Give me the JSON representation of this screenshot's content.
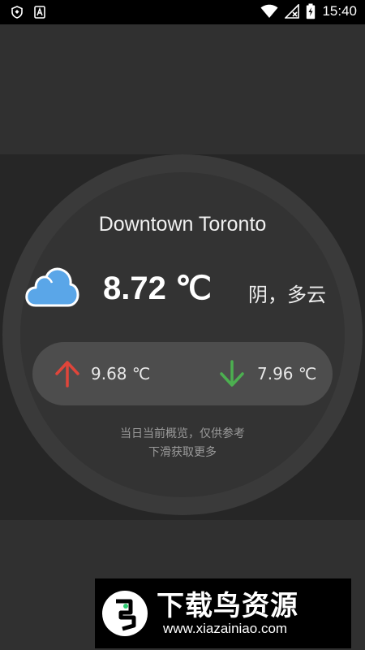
{
  "status_bar": {
    "time": "15:40",
    "left_icons": [
      "shield-icon",
      "letter-a-icon"
    ],
    "right_icons": [
      "wifi-icon",
      "signal-off-icon",
      "battery-charging-icon"
    ]
  },
  "weather": {
    "city": "Downtown Toronto",
    "temperature": "8.72 ℃",
    "condition": "阴，多云",
    "icon": "cloud-icon",
    "high": "9.68 ℃",
    "low": "7.96 ℃",
    "note_line1": "当日当前概览，仅供参考",
    "note_line2": "下滑获取更多"
  },
  "colors": {
    "up_arrow": "#e0453a",
    "down_arrow": "#4caf50",
    "cloud_fill": "#5aa6e8",
    "cloud_outline": "#ffffff"
  },
  "watermark": {
    "name": "下载鸟资源",
    "url": "www.xiazainiao.com"
  }
}
